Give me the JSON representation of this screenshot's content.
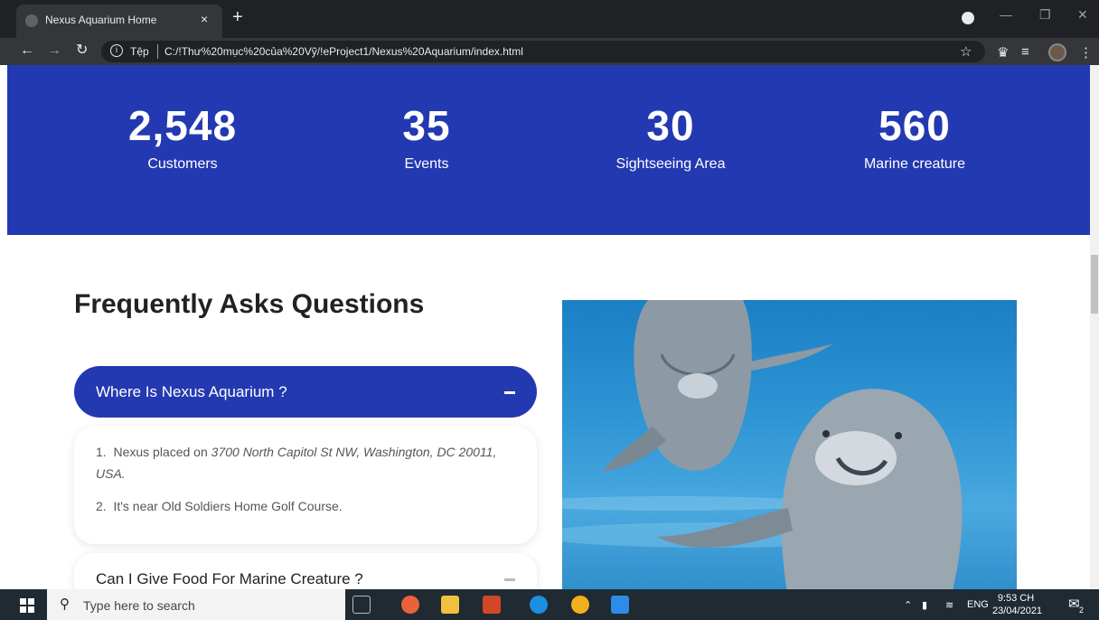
{
  "browser": {
    "tab_title": "Nexus Aquarium Home",
    "tab_close": "×",
    "new_tab": "+",
    "protocol_label": "Tệp",
    "url": "C:/!Thư%20mục%20của%20Vỹ/!eProject1/Nexus%20Aquarium/index.html"
  },
  "stats": [
    {
      "value": "2,548",
      "label": "Customers"
    },
    {
      "value": "35",
      "label": "Events"
    },
    {
      "value": "30",
      "label": "Sightseeing Area"
    },
    {
      "value": "560",
      "label": "Marine creature"
    }
  ],
  "faq": {
    "title": "Frequently Asks Questions",
    "items": [
      {
        "question": "Where Is Nexus Aquarium ?",
        "expanded": true,
        "answers": [
          {
            "num": "1.",
            "prefix": "Nexus placed on ",
            "em": "3700 North Capitol St NW, Washington, DC 20011, USA."
          },
          {
            "num": "2.",
            "text": "It's near Old Soldiers Home Golf Course."
          }
        ]
      },
      {
        "question": "Can I Give Food For Marine Creature ?",
        "expanded": false
      }
    ]
  },
  "colors": {
    "brand": "#2339b1"
  },
  "taskbar": {
    "search_placeholder": "Type here to search",
    "language": "ENG",
    "time": "9:53 CH",
    "date": "23/04/2021",
    "notification_count": "2"
  }
}
